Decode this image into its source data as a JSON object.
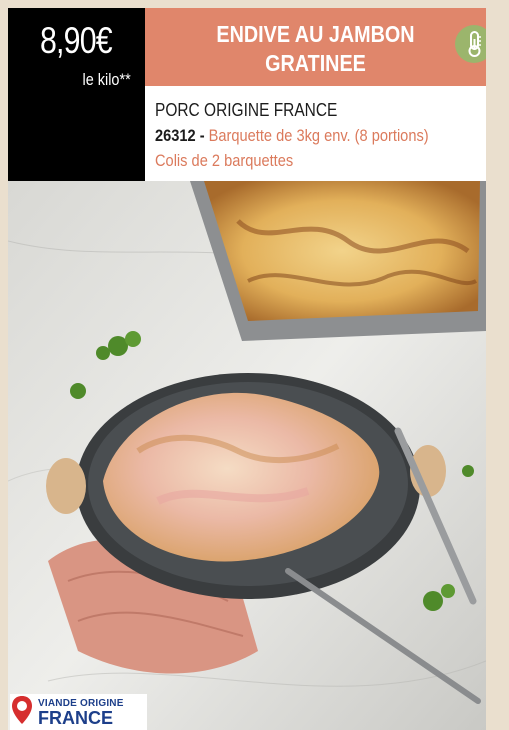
{
  "price": {
    "amount": "8,90€",
    "unit": "le kilo**"
  },
  "product": {
    "title_line1": "ENDIVE AU JAMBON",
    "title_line2": "GRATINEE"
  },
  "details": {
    "origin": "PORC ORIGINE FRANCE",
    "reference": "26312",
    "separator": " - ",
    "package": "Barquette de 3kg env. (8 portions)",
    "colis": "Colis de 2 barquettes"
  },
  "badge": {
    "line1": "VIANDE ORIGINE",
    "line2": "FRANCE"
  },
  "colors": {
    "title_band": "#e0866b",
    "accent_text": "#db7a5c",
    "thermo_badge": "#9bb56c",
    "origin_blue": "#1d3f8a"
  },
  "icons": {
    "temperature": "thermometer-icon",
    "origin": "location-pin-icon"
  }
}
